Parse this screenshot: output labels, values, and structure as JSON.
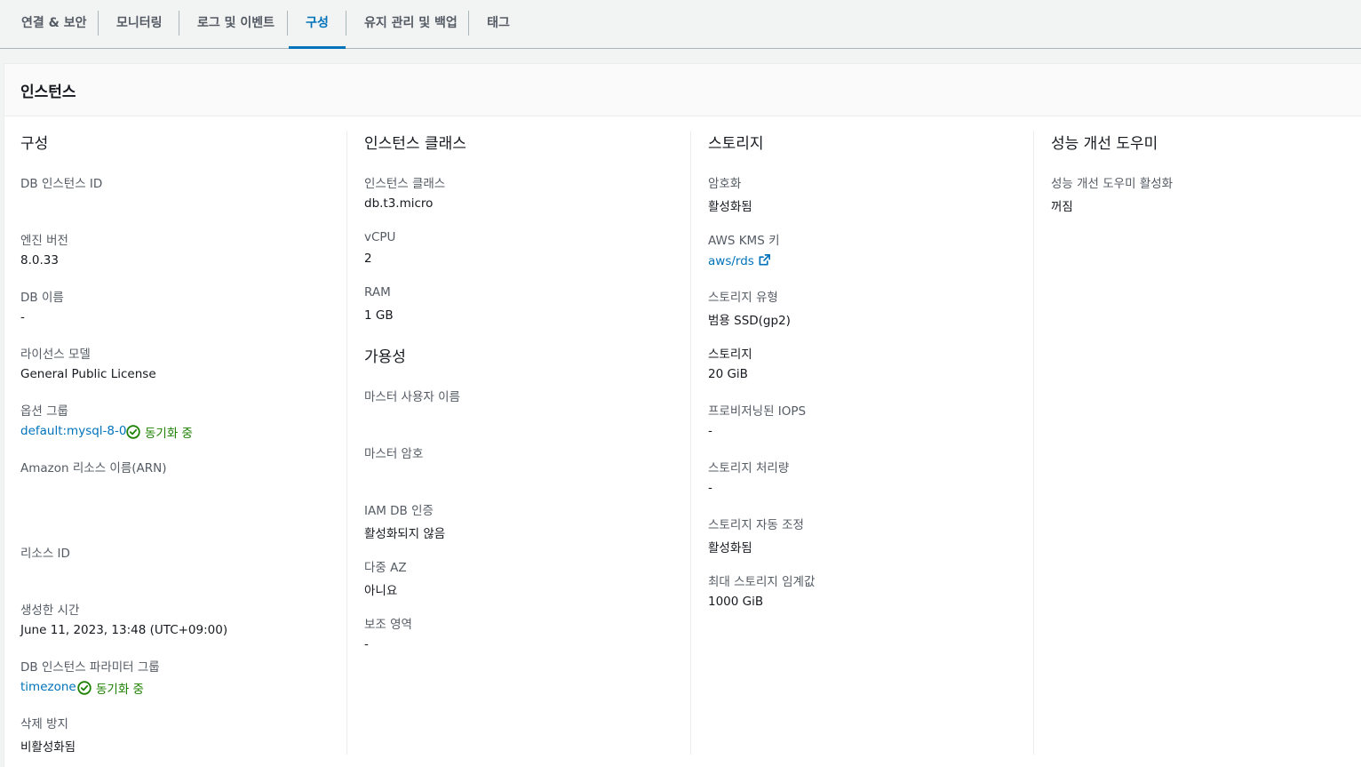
{
  "tabs": [
    {
      "label": "연결 & 보안"
    },
    {
      "label": "모니터링"
    },
    {
      "label": "로그 및 이벤트"
    },
    {
      "label": "구성"
    },
    {
      "label": "유지 관리 및 백업"
    },
    {
      "label": "태그"
    }
  ],
  "active_tab": "구성",
  "panel": {
    "title": "인스턴스"
  },
  "config": {
    "title": "구성",
    "db_instance_id_label": "DB 인스턴스 ID",
    "engine_version_label": "엔진 버전",
    "engine_version_value": "8.0.33",
    "db_name_label": "DB 이름",
    "db_name_value": "-",
    "license_model_label": "라이선스 모델",
    "license_model_value": "General Public License",
    "option_group_label": "옵션 그룹",
    "option_group_value": "default:mysql-8-0",
    "option_group_status": "동기화 중",
    "arn_label": "Amazon 리소스 이름(ARN)",
    "resource_id_label": "리소스 ID",
    "created_time_label": "생성한 시간",
    "created_time_value": "June 11, 2023, 13:48 (UTC+09:00)",
    "param_group_label": "DB 인스턴스 파라미터 그룹",
    "param_group_value": "timezone",
    "param_group_status": "동기화 중",
    "deletion_protection_label": "삭제 방지",
    "deletion_protection_value": "비활성화됨"
  },
  "instance_class": {
    "title": "인스턴스 클래스",
    "class_label": "인스턴스 클래스",
    "class_value": "db.t3.micro",
    "vcpu_label": "vCPU",
    "vcpu_value": "2",
    "ram_label": "RAM",
    "ram_value": "1 GB"
  },
  "availability": {
    "title": "가용성",
    "master_user_label": "마스터 사용자 이름",
    "master_password_label": "마스터 암호",
    "iam_auth_label": "IAM DB 인증",
    "iam_auth_value": "활성화되지 않음",
    "multi_az_label": "다중 AZ",
    "multi_az_value": "아니요",
    "secondary_zone_label": "보조 영역",
    "secondary_zone_value": "-"
  },
  "storage": {
    "title": "스토리지",
    "encryption_label": "암호화",
    "encryption_value": "활성화됨",
    "kms_label": "AWS KMS 키",
    "kms_value": "aws/rds",
    "type_label": "스토리지 유형",
    "type_value": "범용 SSD(gp2)",
    "size_label": "스토리지",
    "size_value": "20 GiB",
    "iops_label": "프로비저닝된 IOPS",
    "iops_value": "-",
    "throughput_label": "스토리지 처리량",
    "throughput_value": "-",
    "autoscaling_label": "스토리지 자동 조정",
    "autoscaling_value": "활성화됨",
    "max_threshold_label": "최대 스토리지 임계값",
    "max_threshold_value": "1000 GiB"
  },
  "performance_insights": {
    "title": "성능 개선 도우미",
    "enabled_label": "성능 개선 도우미 활성화",
    "enabled_value": "꺼짐"
  },
  "colors": {
    "accent": "#0073bb",
    "success": "#1d8102",
    "label": "#545b64",
    "text": "#16191f"
  }
}
